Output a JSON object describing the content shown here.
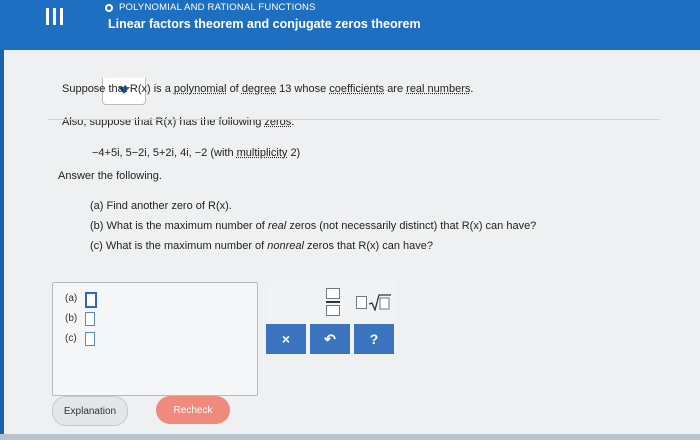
{
  "header": {
    "category": "POLYNOMIAL AND RATIONAL FUNCTIONS",
    "title": "Linear factors theorem and conjugate zeros theorem"
  },
  "problem": {
    "line1": {
      "pre": "Suppose that R(x) is a",
      "polynomial": "polynomial",
      "of": "of",
      "degree": "degree",
      "mid": "13 whose",
      "coefficients": "coefficients",
      "are": "are",
      "real_numbers": "real numbers",
      "end": "."
    },
    "line2": {
      "pre": "Also, suppose that R(x) has the following",
      "zeros": "zeros",
      "end": "."
    },
    "zeros_list": "−4+5i,  5−2i,  5+2i,  4i,  −2 (with",
    "multiplicity": "multiplicity",
    "zeros_tail": "2)",
    "answer_prompt": "Answer the following.",
    "questions": {
      "a": "(a) Find another zero of R(x).",
      "b_pre": "(b) What is the maximum number of",
      "b_real": "real",
      "b_post": "zeros (not necessarily distinct) that R(x) can have?",
      "c_pre": "(c) What is the maximum number of",
      "c_nonreal": "nonreal",
      "c_post": "zeros that R(x) can have?"
    }
  },
  "answers": {
    "a_label": "(a)",
    "b_label": "(b)",
    "c_label": "(c)",
    "a_value": "",
    "b_value": "",
    "c_value": ""
  },
  "toolbar": {
    "clear_label": "×",
    "undo_label": "↶",
    "help_label": "?"
  },
  "footer": {
    "explanation_label": "Explanation",
    "recheck_label": "Recheck"
  },
  "colors": {
    "header_blue": "#1e6fc2",
    "tool_blue": "#3b73bf",
    "recheck_red": "#f08a7c"
  }
}
